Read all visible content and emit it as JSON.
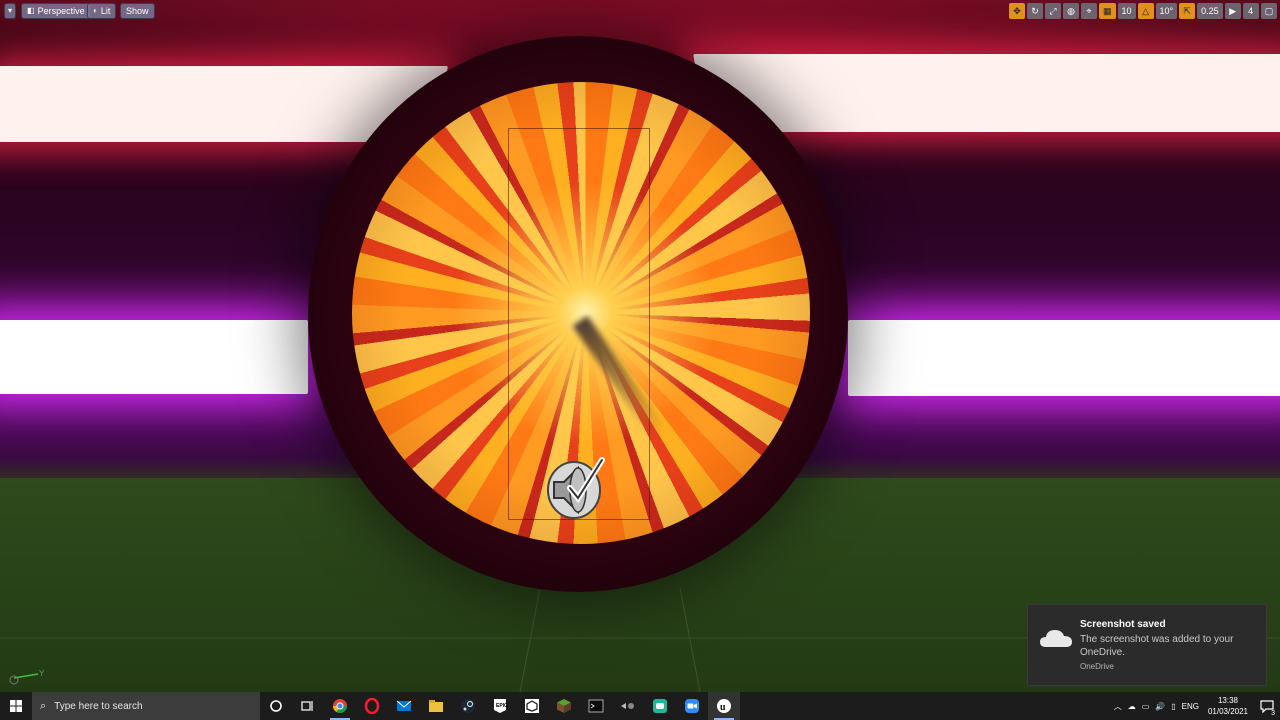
{
  "viewport": {
    "toolbar": {
      "menu_label": "",
      "perspective_label": "Perspective",
      "lit_label": "Lit",
      "show_label": "Show",
      "grid_snap_value": "10",
      "rotation_snap_value": "10°",
      "scale_snap_value": "0.25",
      "camera_speed_value": "4"
    },
    "icons": {
      "speaker_actor": "audio-speaker-icon",
      "axis_gizmo": "axis-gizmo-icon"
    },
    "colors": {
      "portal_accent": "#ff9a22",
      "upper_glow": "#ff2850",
      "mid_glow": "#dc32ff",
      "floor": "#2a4419"
    }
  },
  "toast": {
    "title": "Screenshot saved",
    "body": "The screenshot was added to your OneDrive.",
    "source": "OneDrive"
  },
  "taskbar": {
    "search_placeholder": "Type here to search",
    "apps": [
      "cortana-icon",
      "task-view-icon",
      "chrome-icon",
      "opera-icon",
      "mail-icon",
      "file-explorer-icon",
      "steam-icon",
      "epic-games-icon",
      "unity-icon",
      "minecraft-icon",
      "terminal-icon",
      "app-icon",
      "game-app-icon",
      "zoom-icon",
      "unreal-engine-icon"
    ],
    "tray": {
      "language": "ENG",
      "time": "13:38",
      "date": "01/03/2021",
      "notification_count": "3"
    }
  }
}
